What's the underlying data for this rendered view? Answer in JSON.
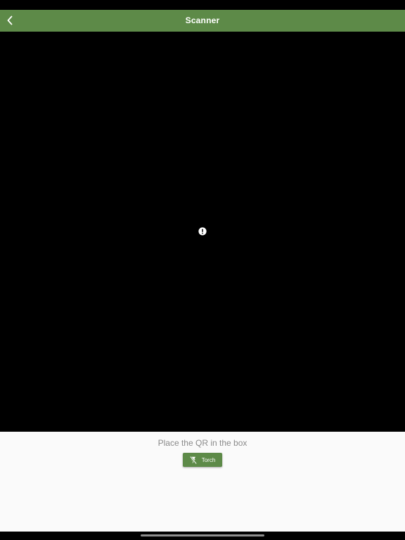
{
  "app_bar": {
    "title": "Scanner",
    "back_icon": "chevron-left-icon"
  },
  "camera": {
    "status_icon": "error-icon"
  },
  "panel": {
    "instruction": "Place the QR in the box",
    "torch_label": "Torch",
    "torch_icon": "flash-off-icon"
  },
  "colors": {
    "app_bar": "#5d8a48",
    "torch_button": "#5d8a48",
    "instruction_text": "#8a8a8a",
    "panel_background": "#fafafa",
    "camera_background": "#000000"
  }
}
